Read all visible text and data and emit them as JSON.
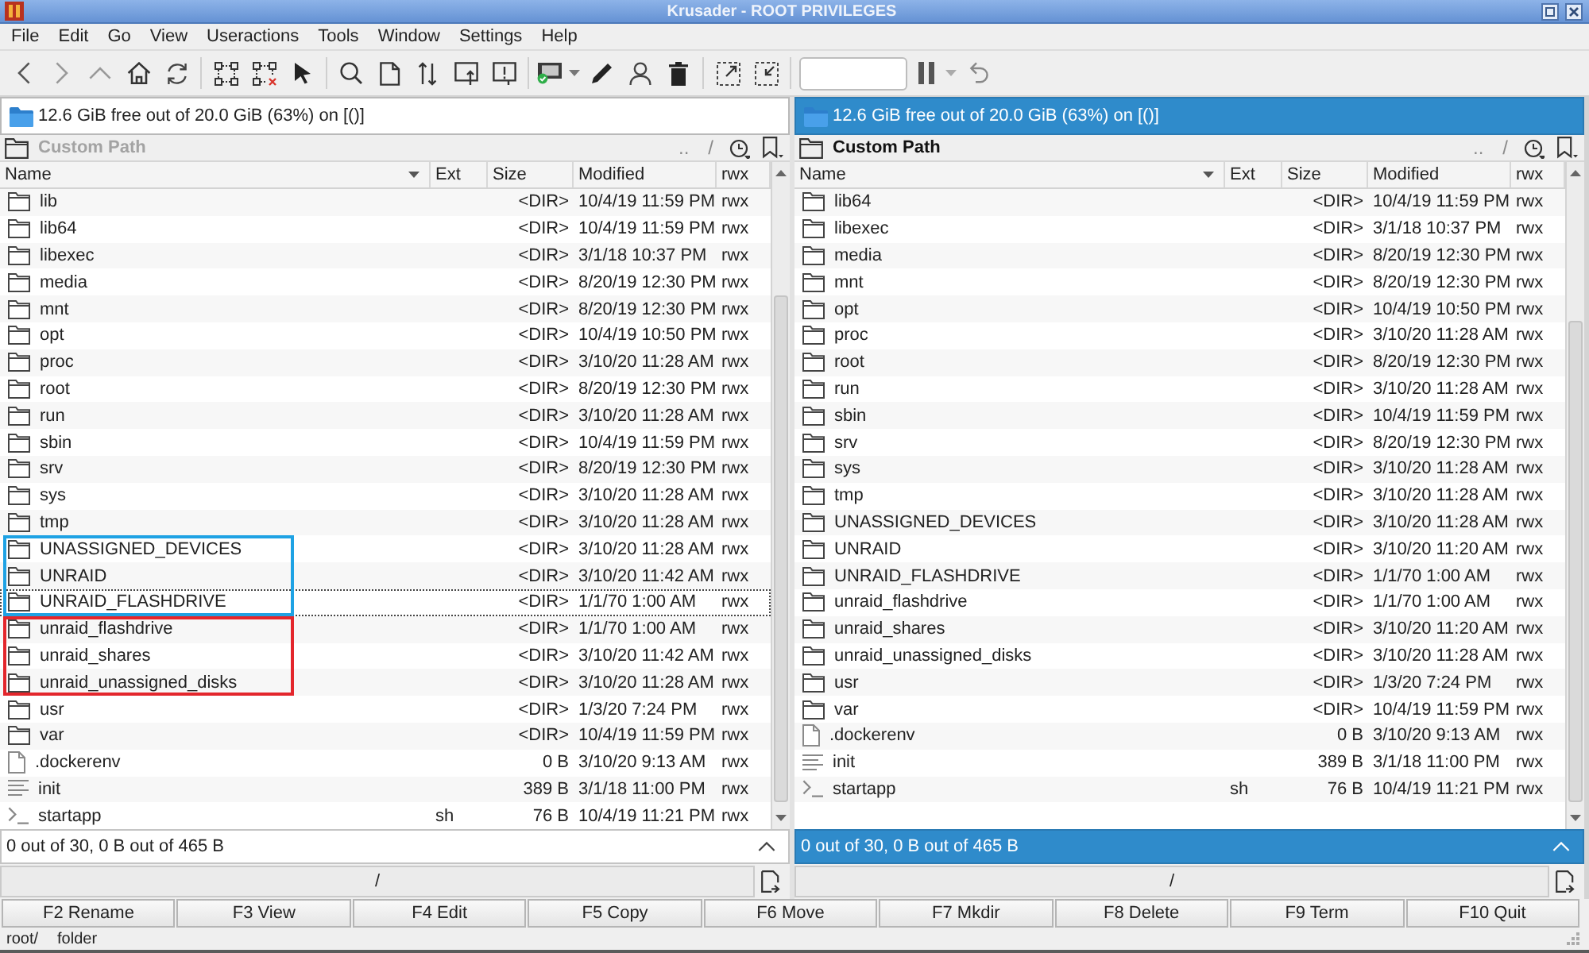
{
  "window": {
    "title": "Krusader - ROOT PRIVILEGES"
  },
  "menu": [
    "File",
    "Edit",
    "Go",
    "View",
    "Useractions",
    "Tools",
    "Window",
    "Settings",
    "Help"
  ],
  "panels": [
    {
      "active": false,
      "disk_info": "12.6 GiB free out of 20.0 GiB (63%) on [()]",
      "path_title": "Custom Path",
      "parent_button": "..",
      "root_button": "/",
      "columns": [
        {
          "label": "Name",
          "sorted": true
        },
        {
          "label": "Ext",
          "sorted": false
        },
        {
          "label": "Size",
          "sorted": false
        },
        {
          "label": "Modified",
          "sorted": false
        },
        {
          "label": "rwx",
          "sorted": false
        }
      ],
      "rows": [
        {
          "kind": "folder",
          "name": "lib",
          "size": "<DIR>",
          "modified": "10/4/19 11:59 PM",
          "rwx": "rwx",
          "current": false
        },
        {
          "kind": "folder",
          "name": "lib64",
          "size": "<DIR>",
          "modified": "10/4/19 11:59 PM",
          "rwx": "rwx",
          "current": false
        },
        {
          "kind": "folder",
          "name": "libexec",
          "size": "<DIR>",
          "modified": "3/1/18 10:37 PM",
          "rwx": "rwx",
          "current": false
        },
        {
          "kind": "folder",
          "name": "media",
          "size": "<DIR>",
          "modified": "8/20/19 12:30 PM",
          "rwx": "rwx",
          "current": false
        },
        {
          "kind": "folder",
          "name": "mnt",
          "size": "<DIR>",
          "modified": "8/20/19 12:30 PM",
          "rwx": "rwx",
          "current": false
        },
        {
          "kind": "folder",
          "name": "opt",
          "size": "<DIR>",
          "modified": "10/4/19 10:50 PM",
          "rwx": "rwx",
          "current": false
        },
        {
          "kind": "folder",
          "name": "proc",
          "size": "<DIR>",
          "modified": "3/10/20 11:28 AM",
          "rwx": "rwx",
          "current": false
        },
        {
          "kind": "folder",
          "name": "root",
          "size": "<DIR>",
          "modified": "8/20/19 12:30 PM",
          "rwx": "rwx",
          "current": false
        },
        {
          "kind": "folder",
          "name": "run",
          "size": "<DIR>",
          "modified": "3/10/20 11:28 AM",
          "rwx": "rwx",
          "current": false
        },
        {
          "kind": "folder",
          "name": "sbin",
          "size": "<DIR>",
          "modified": "10/4/19 11:59 PM",
          "rwx": "rwx",
          "current": false
        },
        {
          "kind": "folder",
          "name": "srv",
          "size": "<DIR>",
          "modified": "8/20/19 12:30 PM",
          "rwx": "rwx",
          "current": false
        },
        {
          "kind": "folder",
          "name": "sys",
          "size": "<DIR>",
          "modified": "3/10/20 11:28 AM",
          "rwx": "rwx",
          "current": false
        },
        {
          "kind": "folder",
          "name": "tmp",
          "size": "<DIR>",
          "modified": "3/10/20 11:28 AM",
          "rwx": "rwx",
          "current": false
        },
        {
          "kind": "folder",
          "name": "UNASSIGNED_DEVICES",
          "size": "<DIR>",
          "modified": "3/10/20 11:28 AM",
          "rwx": "rwx",
          "current": false,
          "color": "#1ea2e4"
        },
        {
          "kind": "folder",
          "name": "UNRAID",
          "size": "<DIR>",
          "modified": "3/10/20 11:42 AM",
          "rwx": "rwx",
          "current": false,
          "color": "#1ea2e4"
        },
        {
          "kind": "folder",
          "name": "UNRAID_FLASHDRIVE",
          "size": "<DIR>",
          "modified": "1/1/70 1:00 AM",
          "rwx": "rwx",
          "current": true,
          "color": "#1ea2e4"
        },
        {
          "kind": "folder",
          "name": "unraid_flashdrive",
          "size": "<DIR>",
          "modified": "1/1/70 1:00 AM",
          "rwx": "rwx",
          "current": false,
          "color": "#e3262c"
        },
        {
          "kind": "folder",
          "name": "unraid_shares",
          "size": "<DIR>",
          "modified": "3/10/20 11:42 AM",
          "rwx": "rwx",
          "current": false,
          "color": "#e3262c"
        },
        {
          "kind": "folder",
          "name": "unraid_unassigned_disks",
          "size": "<DIR>",
          "modified": "3/10/20 11:28 AM",
          "rwx": "rwx",
          "current": false,
          "color": "#e3262c"
        },
        {
          "kind": "folder",
          "name": "usr",
          "size": "<DIR>",
          "modified": "1/3/20 7:24 PM",
          "rwx": "rwx",
          "current": false
        },
        {
          "kind": "folder",
          "name": "var",
          "size": "<DIR>",
          "modified": "10/4/19 11:59 PM",
          "rwx": "rwx",
          "current": false
        },
        {
          "kind": "file",
          "name": ".dockerenv",
          "size": "0 B",
          "modified": "3/10/20 9:13 AM",
          "rwx": "rwx",
          "current": false
        },
        {
          "kind": "text",
          "name": "init",
          "size": "389 B",
          "modified": "3/1/18 11:00 PM",
          "rwx": "rwx",
          "current": false
        },
        {
          "kind": "script",
          "name": "startapp",
          "ext": "sh",
          "size": "76 B",
          "modified": "10/4/19 11:21 PM",
          "rwx": "rwx",
          "current": false
        }
      ],
      "status": "0 out of 30, 0 B out of 465 B",
      "path": "/"
    },
    {
      "active": true,
      "disk_info": "12.6 GiB free out of 20.0 GiB (63%) on [()]",
      "path_title": "Custom Path",
      "parent_button": "..",
      "root_button": "/",
      "columns": [
        {
          "label": "Name",
          "sorted": true
        },
        {
          "label": "Ext",
          "sorted": false
        },
        {
          "label": "Size",
          "sorted": false
        },
        {
          "label": "Modified",
          "sorted": false
        },
        {
          "label": "rwx",
          "sorted": false
        }
      ],
      "rows": [
        {
          "kind": "folder",
          "name": "lib64",
          "size": "<DIR>",
          "modified": "10/4/19 11:59 PM",
          "rwx": "rwx",
          "current": false
        },
        {
          "kind": "folder",
          "name": "libexec",
          "size": "<DIR>",
          "modified": "3/1/18 10:37 PM",
          "rwx": "rwx",
          "current": false
        },
        {
          "kind": "folder",
          "name": "media",
          "size": "<DIR>",
          "modified": "8/20/19 12:30 PM",
          "rwx": "rwx",
          "current": false
        },
        {
          "kind": "folder",
          "name": "mnt",
          "size": "<DIR>",
          "modified": "8/20/19 12:30 PM",
          "rwx": "rwx",
          "current": false
        },
        {
          "kind": "folder",
          "name": "opt",
          "size": "<DIR>",
          "modified": "10/4/19 10:50 PM",
          "rwx": "rwx",
          "current": false
        },
        {
          "kind": "folder",
          "name": "proc",
          "size": "<DIR>",
          "modified": "3/10/20 11:28 AM",
          "rwx": "rwx",
          "current": false
        },
        {
          "kind": "folder",
          "name": "root",
          "size": "<DIR>",
          "modified": "8/20/19 12:30 PM",
          "rwx": "rwx",
          "current": false
        },
        {
          "kind": "folder",
          "name": "run",
          "size": "<DIR>",
          "modified": "3/10/20 11:28 AM",
          "rwx": "rwx",
          "current": false
        },
        {
          "kind": "folder",
          "name": "sbin",
          "size": "<DIR>",
          "modified": "10/4/19 11:59 PM",
          "rwx": "rwx",
          "current": false
        },
        {
          "kind": "folder",
          "name": "srv",
          "size": "<DIR>",
          "modified": "8/20/19 12:30 PM",
          "rwx": "rwx",
          "current": false
        },
        {
          "kind": "folder",
          "name": "sys",
          "size": "<DIR>",
          "modified": "3/10/20 11:28 AM",
          "rwx": "rwx",
          "current": false
        },
        {
          "kind": "folder",
          "name": "tmp",
          "size": "<DIR>",
          "modified": "3/10/20 11:28 AM",
          "rwx": "rwx",
          "current": false
        },
        {
          "kind": "folder",
          "name": "UNASSIGNED_DEVICES",
          "size": "<DIR>",
          "modified": "3/10/20 11:28 AM",
          "rwx": "rwx",
          "current": false
        },
        {
          "kind": "folder",
          "name": "UNRAID",
          "size": "<DIR>",
          "modified": "3/10/20 11:20 AM",
          "rwx": "rwx",
          "current": false
        },
        {
          "kind": "folder",
          "name": "UNRAID_FLASHDRIVE",
          "size": "<DIR>",
          "modified": "1/1/70 1:00 AM",
          "rwx": "rwx",
          "current": false
        },
        {
          "kind": "folder",
          "name": "unraid_flashdrive",
          "size": "<DIR>",
          "modified": "1/1/70 1:00 AM",
          "rwx": "rwx",
          "current": false
        },
        {
          "kind": "folder",
          "name": "unraid_shares",
          "size": "<DIR>",
          "modified": "3/10/20 11:20 AM",
          "rwx": "rwx",
          "current": false
        },
        {
          "kind": "folder",
          "name": "unraid_unassigned_disks",
          "size": "<DIR>",
          "modified": "3/10/20 11:28 AM",
          "rwx": "rwx",
          "current": false
        },
        {
          "kind": "folder",
          "name": "usr",
          "size": "<DIR>",
          "modified": "1/3/20 7:24 PM",
          "rwx": "rwx",
          "current": false
        },
        {
          "kind": "folder",
          "name": "var",
          "size": "<DIR>",
          "modified": "10/4/19 11:59 PM",
          "rwx": "rwx",
          "current": false
        },
        {
          "kind": "file",
          "name": ".dockerenv",
          "size": "0 B",
          "modified": "3/10/20 9:13 AM",
          "rwx": "rwx",
          "current": false
        },
        {
          "kind": "text",
          "name": "init",
          "size": "389 B",
          "modified": "3/1/18 11:00 PM",
          "rwx": "rwx",
          "current": false
        },
        {
          "kind": "script",
          "name": "startapp",
          "ext": "sh",
          "size": "76 B",
          "modified": "10/4/19 11:21 PM",
          "rwx": "rwx",
          "current": false
        }
      ],
      "status": "0 out of 30, 0 B out of 465 B",
      "path": "/"
    }
  ],
  "function_keys": [
    "F2 Rename",
    "F3 View",
    "F4 Edit",
    "F5 Copy",
    "F6 Move",
    "F7 Mkdir",
    "F8 Delete",
    "F9 Term",
    "F10 Quit"
  ],
  "status_bar": [
    "root/",
    "folder"
  ]
}
